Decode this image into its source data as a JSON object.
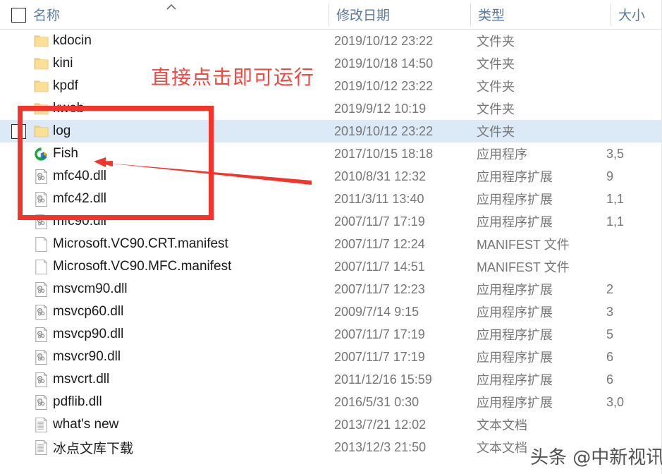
{
  "colors": {
    "annotation_red": "#f4342b",
    "annotation_text_red": "#f4473f",
    "selection_blue": "#dceaf7",
    "header_text": "#5a7a9e",
    "meta_text": "#767676",
    "folder_yellow": "#f5d282"
  },
  "header": {
    "select_all_checkbox": "",
    "columns": [
      {
        "key": "name",
        "label": "名称",
        "sorted": "ascending",
        "sort_icon": "chevron-up-icon"
      },
      {
        "key": "date",
        "label": "修改日期"
      },
      {
        "key": "type",
        "label": "类型"
      },
      {
        "key": "size",
        "label": "大小"
      }
    ]
  },
  "annotations": {
    "callout_text": "直接点击即可运行",
    "highlight_box": {
      "rows": [
        "kweb",
        "log",
        "Fish",
        "mfc40.dll",
        "mfc42.dll"
      ]
    },
    "arrow": {
      "points_to": "Fish",
      "direction": "left"
    }
  },
  "watermark": "头条 @中新视讯",
  "files": [
    {
      "name": "kdocin",
      "icon": "folder-icon",
      "date": "2019/10/12 23:22",
      "type": "文件夹",
      "size": "",
      "selected": false,
      "checkbox": false
    },
    {
      "name": "kini",
      "icon": "folder-icon",
      "date": "2019/10/18 14:50",
      "type": "文件夹",
      "size": "",
      "selected": false,
      "checkbox": false
    },
    {
      "name": "kpdf",
      "icon": "folder-icon",
      "date": "2019/10/12 23:22",
      "type": "文件夹",
      "size": "",
      "selected": false,
      "checkbox": false
    },
    {
      "name": "kweb",
      "icon": "folder-icon",
      "date": "2019/9/12 10:19",
      "type": "文件夹",
      "size": "",
      "selected": false,
      "checkbox": false
    },
    {
      "name": "log",
      "icon": "folder-icon",
      "date": "2019/10/12 23:22",
      "type": "文件夹",
      "size": "",
      "selected": true,
      "checkbox": true
    },
    {
      "name": "Fish",
      "icon": "fish-app-icon",
      "date": "2017/10/15 18:18",
      "type": "应用程序",
      "size": "3,5",
      "selected": false,
      "checkbox": false
    },
    {
      "name": "mfc40.dll",
      "icon": "dll-icon",
      "date": "2010/8/31 12:32",
      "type": "应用程序扩展",
      "size": "9",
      "selected": false,
      "checkbox": false
    },
    {
      "name": "mfc42.dll",
      "icon": "dll-icon",
      "date": "2011/3/11 13:40",
      "type": "应用程序扩展",
      "size": "1,1",
      "selected": false,
      "checkbox": false
    },
    {
      "name": "mfc90.dll",
      "icon": "dll-icon",
      "date": "2007/11/7 17:19",
      "type": "应用程序扩展",
      "size": "1,1",
      "selected": false,
      "checkbox": false
    },
    {
      "name": "Microsoft.VC90.CRT.manifest",
      "icon": "manifest-icon",
      "date": "2007/11/7 12:24",
      "type": "MANIFEST 文件",
      "size": "",
      "selected": false,
      "checkbox": false
    },
    {
      "name": "Microsoft.VC90.MFC.manifest",
      "icon": "manifest-icon",
      "date": "2007/11/7 14:51",
      "type": "MANIFEST 文件",
      "size": "",
      "selected": false,
      "checkbox": false
    },
    {
      "name": "msvcm90.dll",
      "icon": "dll-icon",
      "date": "2007/11/7 12:23",
      "type": "应用程序扩展",
      "size": "2",
      "selected": false,
      "checkbox": false
    },
    {
      "name": "msvcp60.dll",
      "icon": "dll-icon",
      "date": "2009/7/14 9:15",
      "type": "应用程序扩展",
      "size": "3",
      "selected": false,
      "checkbox": false
    },
    {
      "name": "msvcp90.dll",
      "icon": "dll-icon",
      "date": "2007/11/7 17:19",
      "type": "应用程序扩展",
      "size": "5",
      "selected": false,
      "checkbox": false
    },
    {
      "name": "msvcr90.dll",
      "icon": "dll-icon",
      "date": "2007/11/7 17:19",
      "type": "应用程序扩展",
      "size": "6",
      "selected": false,
      "checkbox": false
    },
    {
      "name": "msvcrt.dll",
      "icon": "dll-icon",
      "date": "2011/12/16 15:59",
      "type": "应用程序扩展",
      "size": "6",
      "selected": false,
      "checkbox": false
    },
    {
      "name": "pdflib.dll",
      "icon": "dll-icon",
      "date": "2016/5/31 0:30",
      "type": "应用程序扩展",
      "size": "3,0",
      "selected": false,
      "checkbox": false
    },
    {
      "name": "what's new",
      "icon": "text-doc-icon",
      "date": "2013/7/21 12:02",
      "type": "文本文档",
      "size": "",
      "selected": false,
      "checkbox": false
    },
    {
      "name": "冰点文库下载",
      "icon": "text-doc-icon",
      "date": "2013/12/3 21:50",
      "type": "文本文档",
      "size": "",
      "selected": false,
      "checkbox": false
    }
  ]
}
